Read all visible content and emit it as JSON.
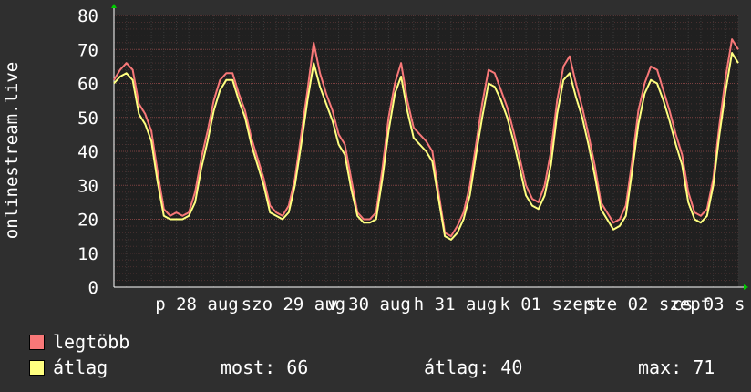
{
  "chart_data": {
    "type": "line",
    "ylabel": "onlinestream.live",
    "ylim": [
      0,
      80
    ],
    "yticks": [
      0,
      10,
      20,
      30,
      40,
      50,
      60,
      70,
      80
    ],
    "xticks": [
      "p 28 aug",
      "szo 29 aug",
      "v 30 aug",
      "h 31 aug",
      "k 01 szept",
      "sze 02 szept",
      "cs 03 s"
    ],
    "samples_per_day": 12,
    "series": [
      {
        "name": "legtöbb",
        "color": "#f87878",
        "values": [
          61,
          64,
          66,
          64,
          54,
          51,
          46,
          34,
          23,
          21,
          22,
          21,
          22,
          28,
          38,
          46,
          55,
          61,
          63,
          63,
          57,
          52,
          44,
          38,
          32,
          24,
          22,
          21,
          24,
          32,
          45,
          58,
          72,
          63,
          57,
          52,
          45,
          42,
          32,
          22,
          20,
          20,
          22,
          35,
          50,
          60,
          66,
          55,
          47,
          45,
          43,
          40,
          28,
          16,
          15,
          18,
          22,
          30,
          42,
          54,
          64,
          63,
          58,
          53,
          46,
          38,
          30,
          26,
          25,
          30,
          40,
          55,
          65,
          68,
          60,
          53,
          45,
          36,
          25,
          22,
          19,
          20,
          24,
          37,
          52,
          60,
          65,
          64,
          58,
          52,
          45,
          39,
          28,
          22,
          21,
          23,
          32,
          48,
          62,
          73,
          70
        ]
      },
      {
        "name": "átlag",
        "color": "#ffff80",
        "values": [
          60,
          62,
          63,
          61,
          51,
          48,
          43,
          31,
          21,
          20,
          20,
          20,
          21,
          25,
          35,
          43,
          52,
          58,
          61,
          61,
          55,
          50,
          42,
          36,
          30,
          22,
          21,
          20,
          22,
          30,
          42,
          55,
          66,
          59,
          54,
          49,
          42,
          39,
          29,
          21,
          19,
          19,
          20,
          32,
          46,
          57,
          62,
          52,
          44,
          42,
          40,
          37,
          26,
          15,
          14,
          16,
          20,
          27,
          39,
          50,
          60,
          59,
          55,
          50,
          43,
          35,
          27,
          24,
          23,
          27,
          36,
          51,
          61,
          63,
          56,
          50,
          42,
          33,
          23,
          20,
          17,
          18,
          21,
          34,
          48,
          57,
          61,
          60,
          55,
          49,
          42,
          36,
          25,
          20,
          19,
          21,
          30,
          45,
          58,
          69,
          66
        ]
      }
    ],
    "grid": true
  },
  "legend": {
    "items": [
      {
        "label": "legtöbb",
        "color": "#f87878"
      },
      {
        "label": "átlag",
        "color": "#ffff80"
      }
    ],
    "stats": {
      "now": "most: 66",
      "avg": "átlag: 40",
      "max": "max: 71"
    }
  }
}
